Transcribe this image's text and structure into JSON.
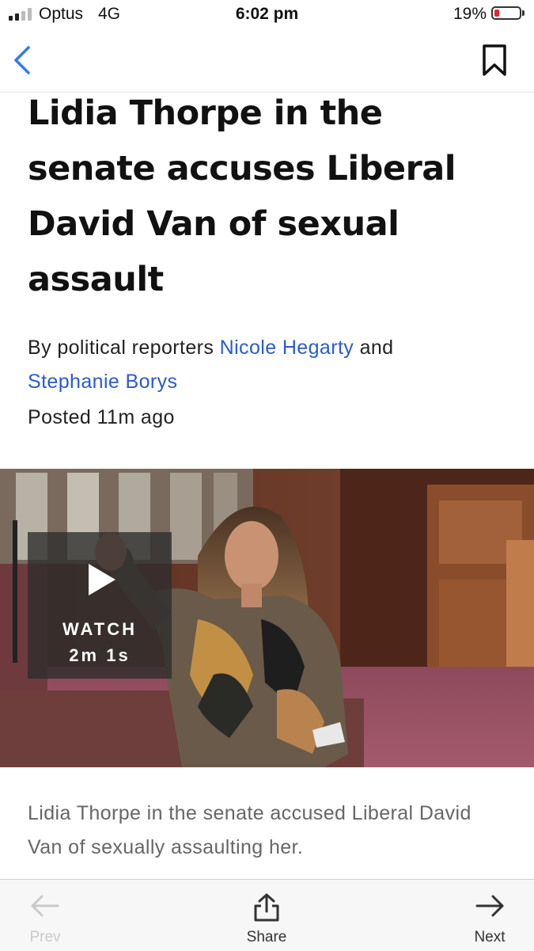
{
  "status_bar": {
    "carrier": "Optus",
    "network": "4G",
    "time": "6:02 pm",
    "battery_percent": "19%",
    "battery_level": 0.19,
    "battery_color": "#e3262f"
  },
  "nav": {
    "back_icon": "chevron-left-icon",
    "bookmark_icon": "bookmark-icon",
    "accent_color": "#3478f6"
  },
  "article": {
    "headline": "Lidia Thorpe in the senate accuses Liberal David Van of sexual assault",
    "byline_prefix": "By political reporters",
    "author_1": "Nicole Hegarty",
    "byline_join": "and",
    "author_2": "Stephanie Borys",
    "link_color": "#2a5bcc",
    "posted": "Posted 11m ago"
  },
  "video": {
    "watch_label": "WATCH",
    "duration": "2m 1s",
    "play_icon": "play-icon",
    "caption": "Lidia Thorpe in the senate accused Liberal David Van of sexually assaulting her."
  },
  "toolbar": {
    "prev_label": "Prev",
    "share_label": "Share",
    "next_label": "Next",
    "prev_icon": "arrow-left-icon",
    "share_icon": "share-icon",
    "next_icon": "arrow-right-icon"
  }
}
